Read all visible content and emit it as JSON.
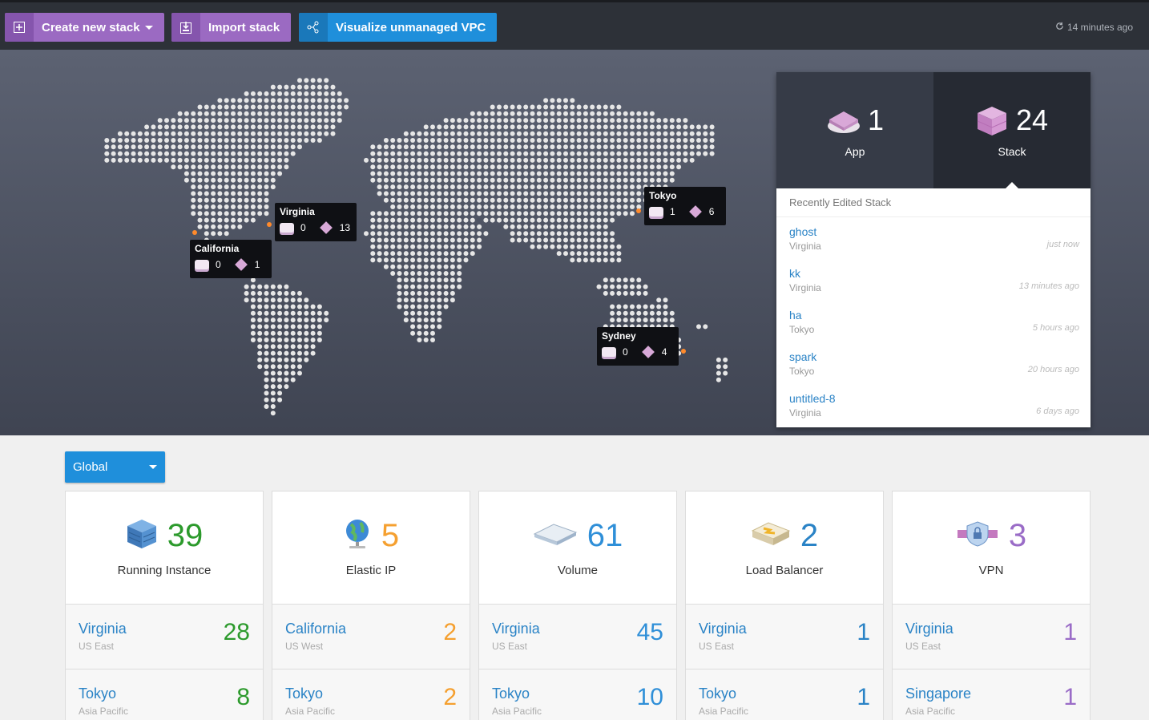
{
  "toolbar": {
    "create_label": "Create new stack",
    "import_label": "Import stack",
    "vpc_label": "Visualize unmanaged VPC",
    "refresh_text": "14 minutes ago"
  },
  "map_regions": [
    {
      "name": "Virginia",
      "apps": "0",
      "stacks": "13"
    },
    {
      "name": "California",
      "apps": "0",
      "stacks": "1"
    },
    {
      "name": "Tokyo",
      "apps": "1",
      "stacks": "6"
    },
    {
      "name": "Sydney",
      "apps": "0",
      "stacks": "4"
    }
  ],
  "summary": {
    "app_count": "1",
    "app_label": "App",
    "stack_count": "24",
    "stack_label": "Stack",
    "recent_title": "Recently Edited Stack",
    "recent": [
      {
        "name": "ghost",
        "region": "Virginia",
        "time": "just now"
      },
      {
        "name": "kk",
        "region": "Virginia",
        "time": "13 minutes ago"
      },
      {
        "name": "ha",
        "region": "Tokyo",
        "time": "5 hours ago"
      },
      {
        "name": "spark",
        "region": "Tokyo",
        "time": "20 hours ago"
      },
      {
        "name": "untitled-8",
        "region": "Virginia",
        "time": "6 days ago"
      }
    ]
  },
  "filter": {
    "label": "Global"
  },
  "cards": [
    {
      "name": "Running Instance",
      "total": "39",
      "icon": "instance-icon",
      "rows": [
        {
          "region": "Virginia",
          "sub": "US East",
          "value": "28"
        },
        {
          "region": "Tokyo",
          "sub": "Asia Pacific",
          "value": "8"
        }
      ]
    },
    {
      "name": "Elastic IP",
      "total": "5",
      "icon": "globe-icon",
      "rows": [
        {
          "region": "California",
          "sub": "US West",
          "value": "2"
        },
        {
          "region": "Tokyo",
          "sub": "Asia Pacific",
          "value": "2"
        }
      ]
    },
    {
      "name": "Volume",
      "total": "61",
      "icon": "volume-icon",
      "rows": [
        {
          "region": "Virginia",
          "sub": "US East",
          "value": "45"
        },
        {
          "region": "Tokyo",
          "sub": "Asia Pacific",
          "value": "10"
        }
      ]
    },
    {
      "name": "Load Balancer",
      "total": "2",
      "icon": "load-balancer-icon",
      "rows": [
        {
          "region": "Virginia",
          "sub": "US East",
          "value": "1"
        },
        {
          "region": "Tokyo",
          "sub": "Asia Pacific",
          "value": "1"
        }
      ]
    },
    {
      "name": "VPN",
      "total": "3",
      "icon": "vpn-icon",
      "rows": [
        {
          "region": "Virginia",
          "sub": "US East",
          "value": "1"
        },
        {
          "region": "Singapore",
          "sub": "Asia Pacific",
          "value": "1"
        }
      ]
    }
  ],
  "colors": {
    "accent_purple": "#9b6ac2",
    "accent_blue": "#1f8fdb",
    "instance": "#2c9a2c",
    "elastic_ip": "#f5a030",
    "volume": "#2f8fd8",
    "load_balancer": "#2a83c6",
    "vpn": "#9a6cc7"
  }
}
